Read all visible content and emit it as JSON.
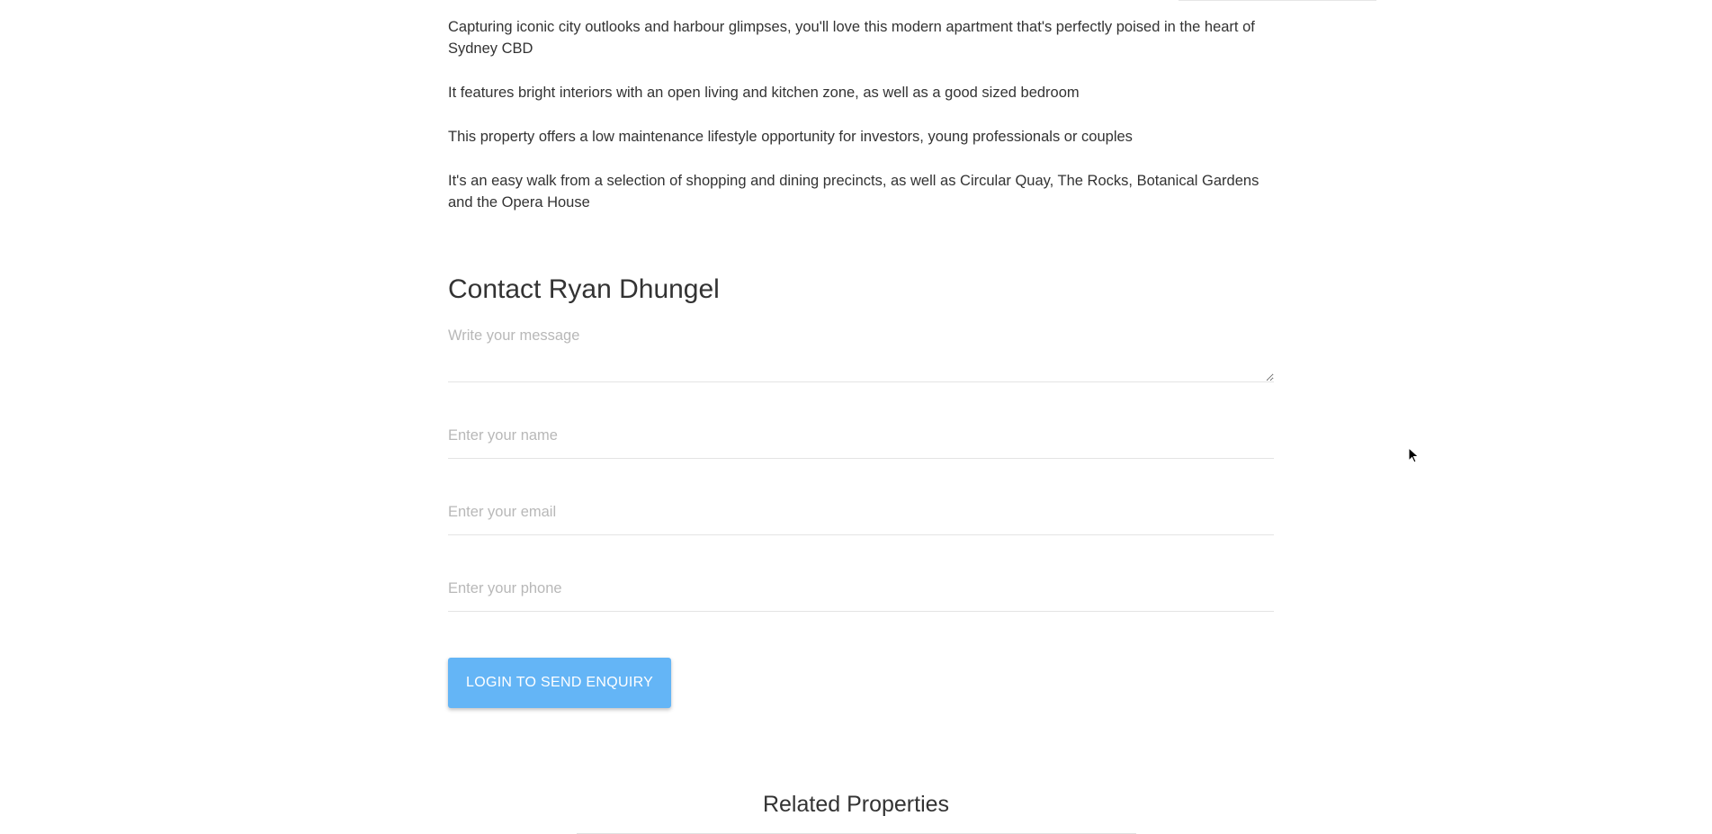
{
  "description": {
    "paragraphs": [
      "Capturing iconic city outlooks and harbour glimpses, you'll love this modern apartment that's perfectly poised in the heart of Sydney CBD",
      "It features bright interiors with an open living and kitchen zone, as well as a good sized bedroom",
      "This property offers a low maintenance lifestyle opportunity for investors, young professionals or couples",
      "It's an easy walk from a selection of shopping and dining precincts, as well as Circular Quay, The Rocks, Botanical Gardens and the Opera House"
    ]
  },
  "contact": {
    "title": "Contact Ryan Dhungel",
    "message_placeholder": "Write your message",
    "name_placeholder": "Enter your name",
    "email_placeholder": "Enter your email",
    "phone_placeholder": "Enter your phone",
    "send_label": "LOGIN TO SEND ENQUIRY"
  },
  "related": {
    "title": "Related Properties"
  },
  "colors": {
    "button_bg": "#64b5f6",
    "text": "#333333",
    "placeholder": "#b8b8b8"
  },
  "icons": {
    "cursor": "mouse-pointer-icon"
  }
}
